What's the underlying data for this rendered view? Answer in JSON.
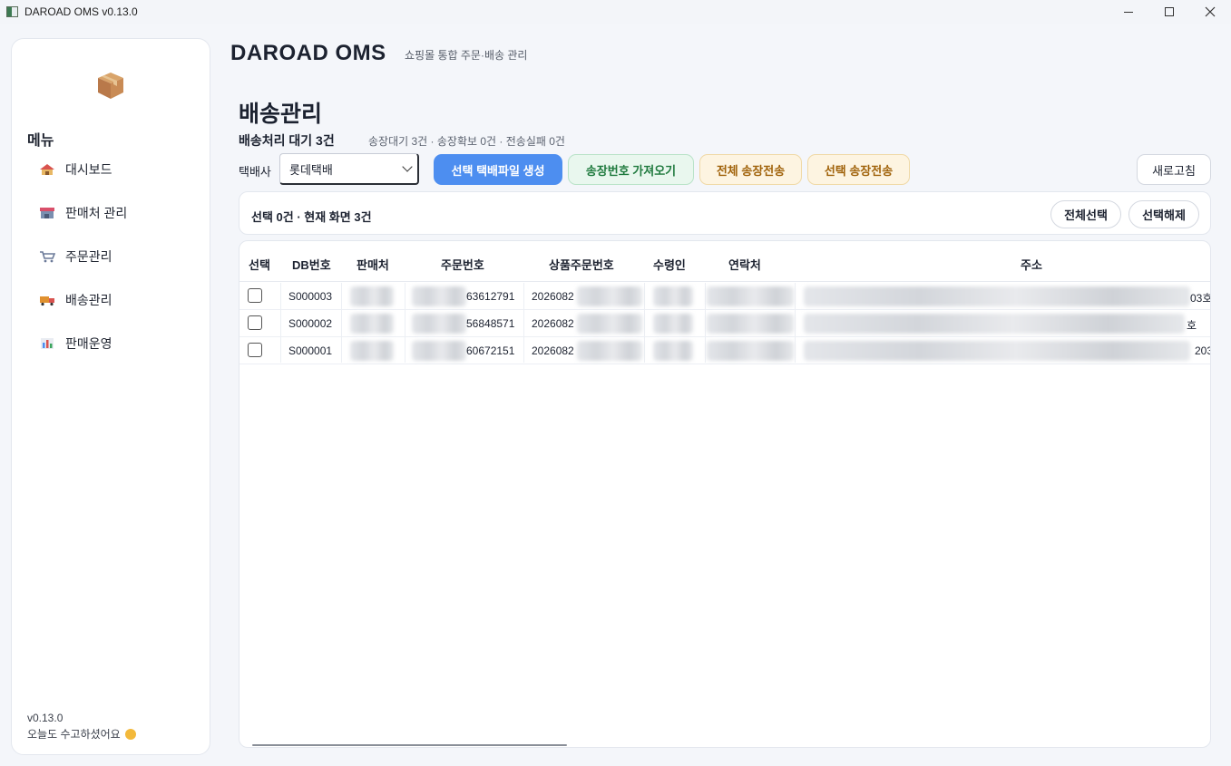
{
  "window": {
    "title": "DAROAD OMS v0.13.0",
    "controls": [
      "minimize",
      "maximize",
      "close"
    ]
  },
  "sidebar": {
    "logo_icon": "package-box-icon",
    "menu_title": "메뉴",
    "items": [
      {
        "label": "대시보드",
        "icon": "house-icon"
      },
      {
        "label": "판매처 관리",
        "icon": "store-icon"
      },
      {
        "label": "주문관리",
        "icon": "cart-icon"
      },
      {
        "label": "배송관리",
        "icon": "truck-icon"
      },
      {
        "label": "판매운영",
        "icon": "bar-chart-icon"
      }
    ],
    "version": "v0.13.0",
    "greeting": "오늘도 수고하셨어요",
    "greeting_icon": "smile-emoji-icon"
  },
  "header": {
    "brand": "DAROAD OMS",
    "subtitle": "쇼핑몰 통합 주문·배송 관리"
  },
  "page": {
    "title": "배송관리",
    "summary": "배송처리 대기 3건",
    "summary_detail": "송장대기 3건 · 송장확보 0건 · 전송실패 0건"
  },
  "toolbar": {
    "courier_label": "택배사",
    "courier_selected": "롯데택배",
    "generate_label": "선택 택배파일 생성",
    "fetch_label": "송장번호 가져오기",
    "send_all_label": "전체 송장전송",
    "send_selected_label": "선택 송장전송",
    "refresh_label": "새로고침"
  },
  "selection": {
    "text": "선택 0건 · 현재 화면 3건",
    "select_all_label": "전체선택",
    "deselect_label": "선택해제"
  },
  "table": {
    "columns": [
      "선택",
      "DB번호",
      "판매처",
      "주문번호",
      "상품주문번호",
      "수령인",
      "연락처",
      "주소"
    ],
    "rows": [
      {
        "db": "S000003",
        "order_suffix": "63612791",
        "product_prefix": "2026082",
        "addr_tail": "03호"
      },
      {
        "db": "S000002",
        "order_suffix": "56848571",
        "product_prefix": "2026082",
        "addr_tail": "호"
      },
      {
        "db": "S000001",
        "order_suffix": "60672151",
        "product_prefix": "2026082",
        "addr_tail": "203"
      }
    ]
  },
  "colors": {
    "primary": "#4d8ef0",
    "success_bg": "#e9f7ee",
    "warning_bg": "#fdf4e1",
    "warning_text": "#a0620a"
  }
}
